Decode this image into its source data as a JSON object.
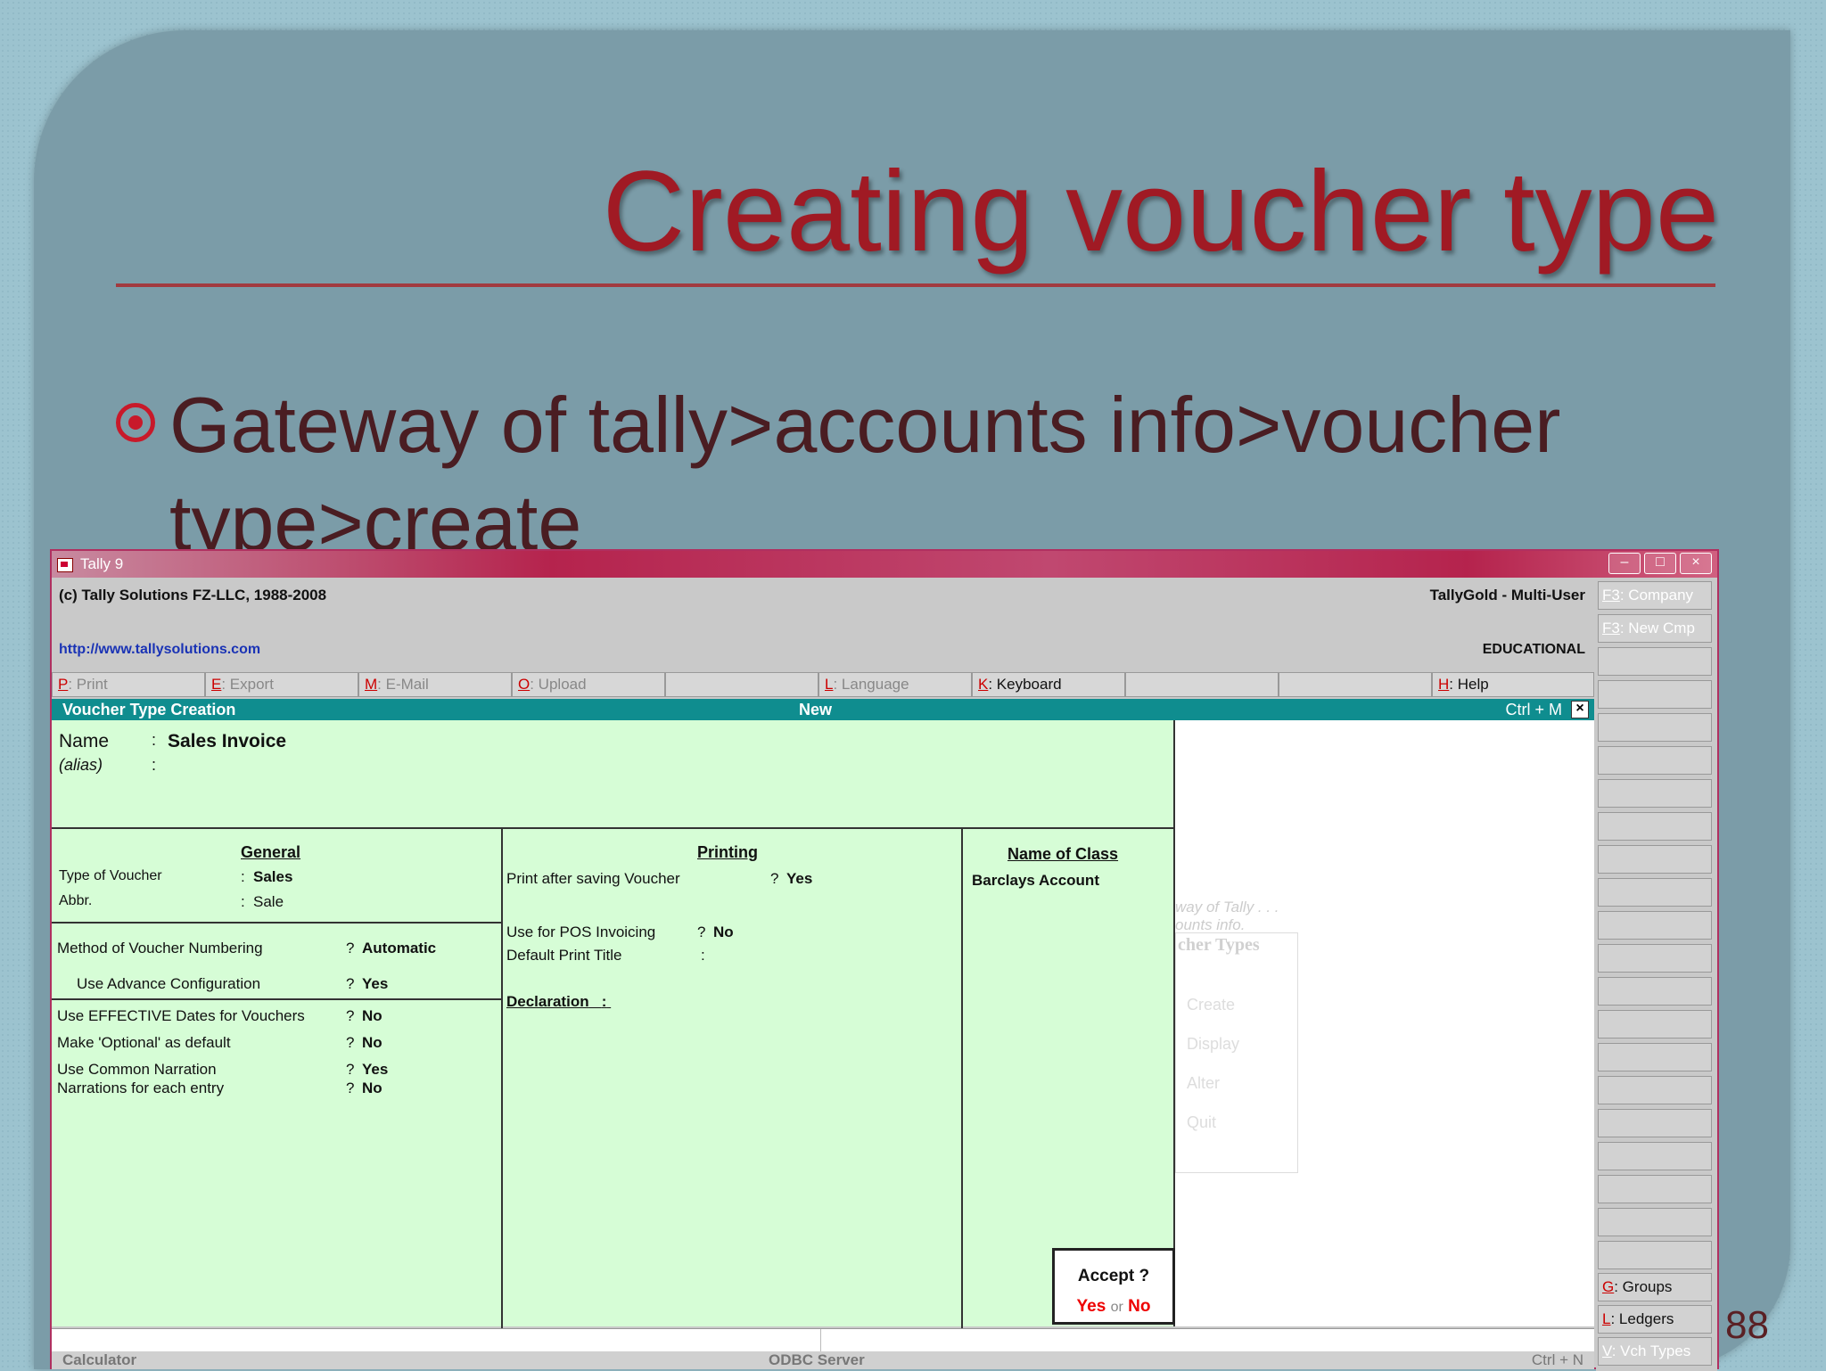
{
  "slide": {
    "title": "Creating voucher type",
    "bullet": "Gateway of tally>accounts info>voucher type>create",
    "page_number": "88"
  },
  "window": {
    "title": "Tally 9",
    "controls": [
      "–",
      "□",
      "×"
    ]
  },
  "header": {
    "copyright": "(c) Tally Solutions FZ-LLC, 1988-2008",
    "product": "TallyGold - Multi-User",
    "url": "http://www.tallysolutions.com",
    "edition": "EDUCATIONAL"
  },
  "button_bar": [
    {
      "key": "P",
      "label": ": Print",
      "active": false
    },
    {
      "key": "E",
      "label": ": Export",
      "active": false
    },
    {
      "key": "M",
      "label": ": E-Mail",
      "active": false
    },
    {
      "key": "O",
      "label": ": Upload",
      "active": false
    },
    {
      "key": "",
      "label": "",
      "active": false
    },
    {
      "key": "L",
      "label": ": Language",
      "active": false
    },
    {
      "key": "K",
      "label": ": Keyboard",
      "active": true
    },
    {
      "key": "",
      "label": "",
      "active": false
    },
    {
      "key": "",
      "label": "",
      "active": false
    },
    {
      "key": "H",
      "label": ": Help",
      "active": true
    }
  ],
  "form_bar": {
    "title": "Voucher Type Creation",
    "mode": "New",
    "shortcut": "Ctrl + M",
    "close": "×"
  },
  "form": {
    "name_label": "Name",
    "name_value": "Sales Invoice",
    "alias_label": "(alias)",
    "colon": ":",
    "general": {
      "heading": "General",
      "type_label": "Type of Voucher",
      "type_value": "Sales",
      "abbr_label": "Abbr.",
      "abbr_value": "Sale",
      "numbering_label": "Method of Voucher Numbering",
      "numbering_value": "Automatic",
      "advance_label": "Use Advance Configuration",
      "advance_value": "Yes",
      "effective_label": "Use EFFECTIVE Dates for Vouchers",
      "effective_value": "No",
      "optional_label": "Make 'Optional' as default",
      "optional_value": "No",
      "common_label": "Use Common Narration",
      "common_value": "Yes",
      "each_label": "Narrations for each entry",
      "each_value": "No",
      "q": "?"
    },
    "printing": {
      "heading": "Printing",
      "print_after_label": "Print after saving Voucher",
      "print_after_value": "Yes",
      "pos_label": "Use for POS Invoicing",
      "pos_value": "No",
      "default_title_label": "Default Print Title",
      "declaration_label": "Declaration",
      "q": "?"
    },
    "class": {
      "heading": "Name of Class",
      "value": "Barclays Account"
    }
  },
  "accept": {
    "question": "Accept ?",
    "yes": "Yes",
    "or": "or",
    "no": "No"
  },
  "ghost_menu": {
    "gateway_line1": "way of Tally . . .",
    "gateway_line2": "ounts info.",
    "title": "cher Types",
    "items": [
      "Create",
      "Display",
      "Alter",
      "Quit"
    ]
  },
  "status": {
    "calculator": "Calculator",
    "odbc": "ODBC Server",
    "ctrl": "Ctrl + N"
  },
  "side_buttons": [
    {
      "key": "F3",
      "label": ": Company",
      "active": false
    },
    {
      "key": "F3",
      "label": ": New Cmp",
      "active": false
    },
    {
      "key": "G",
      "label": ": Groups",
      "active": true
    },
    {
      "key": "L",
      "label": ": Ledgers",
      "active": true
    },
    {
      "key": "V",
      "label": ": Vch Types",
      "active": false
    }
  ]
}
